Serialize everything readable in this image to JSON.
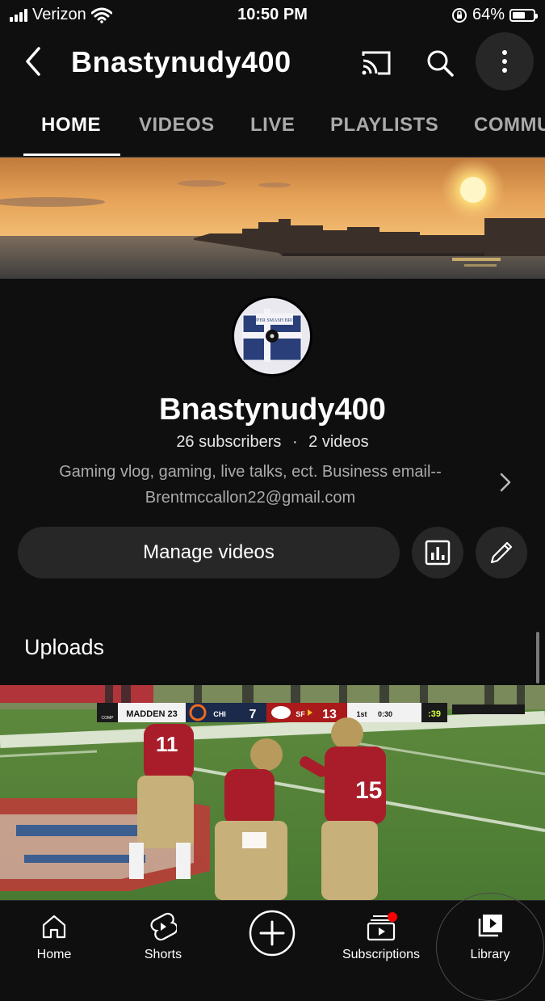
{
  "status_bar": {
    "carrier": "Verizon",
    "time": "10:50 PM",
    "battery_percent": "64%",
    "battery_level": 0.64
  },
  "header": {
    "title": "Bnastynudy400",
    "icons": [
      "back-icon",
      "cast-icon",
      "search-icon",
      "more-vertical-icon"
    ]
  },
  "tabs": [
    {
      "label": "HOME",
      "active": true
    },
    {
      "label": "VIDEOS",
      "active": false
    },
    {
      "label": "LIVE",
      "active": false
    },
    {
      "label": "PLAYLISTS",
      "active": false
    },
    {
      "label": "COMMUNITY",
      "active": false
    }
  ],
  "channel": {
    "name": "Bnastynudy400",
    "subscribers": "26 subscribers",
    "separator": "·",
    "videos": "2 videos",
    "description": "Gaming vlog, gaming, live talks, ect. Business email-- Brentmccallon22@gmail.com",
    "avatar_text": "SUPER SMASH BROS."
  },
  "actions": {
    "manage_label": "Manage videos",
    "analytics_icon": "analytics-icon",
    "edit_icon": "pencil-icon"
  },
  "uploads": {
    "title": "Uploads",
    "video": {
      "scorebug": {
        "game": "MADDEN 23",
        "team1": "CHI",
        "score1": "7",
        "team2": "SF",
        "score2": "13",
        "quarter": "1st",
        "clock": "0:30",
        "playclock": ":39",
        "badge": "COMP"
      },
      "jersey_numbers": [
        "11",
        "15"
      ]
    }
  },
  "bottom_nav": [
    {
      "label": "Home",
      "icon": "home-icon"
    },
    {
      "label": "Shorts",
      "icon": "shorts-icon"
    },
    {
      "label": "",
      "icon": "create-plus-icon"
    },
    {
      "label": "Subscriptions",
      "icon": "subscriptions-icon",
      "notification": true
    },
    {
      "label": "Library",
      "icon": "library-icon"
    }
  ],
  "colors": {
    "background": "#0f0f0f",
    "button_bg": "#272727",
    "text_secondary": "#aaaaaa",
    "notification_dot": "#ff0000",
    "sunset_orange": "#e9a14a"
  }
}
